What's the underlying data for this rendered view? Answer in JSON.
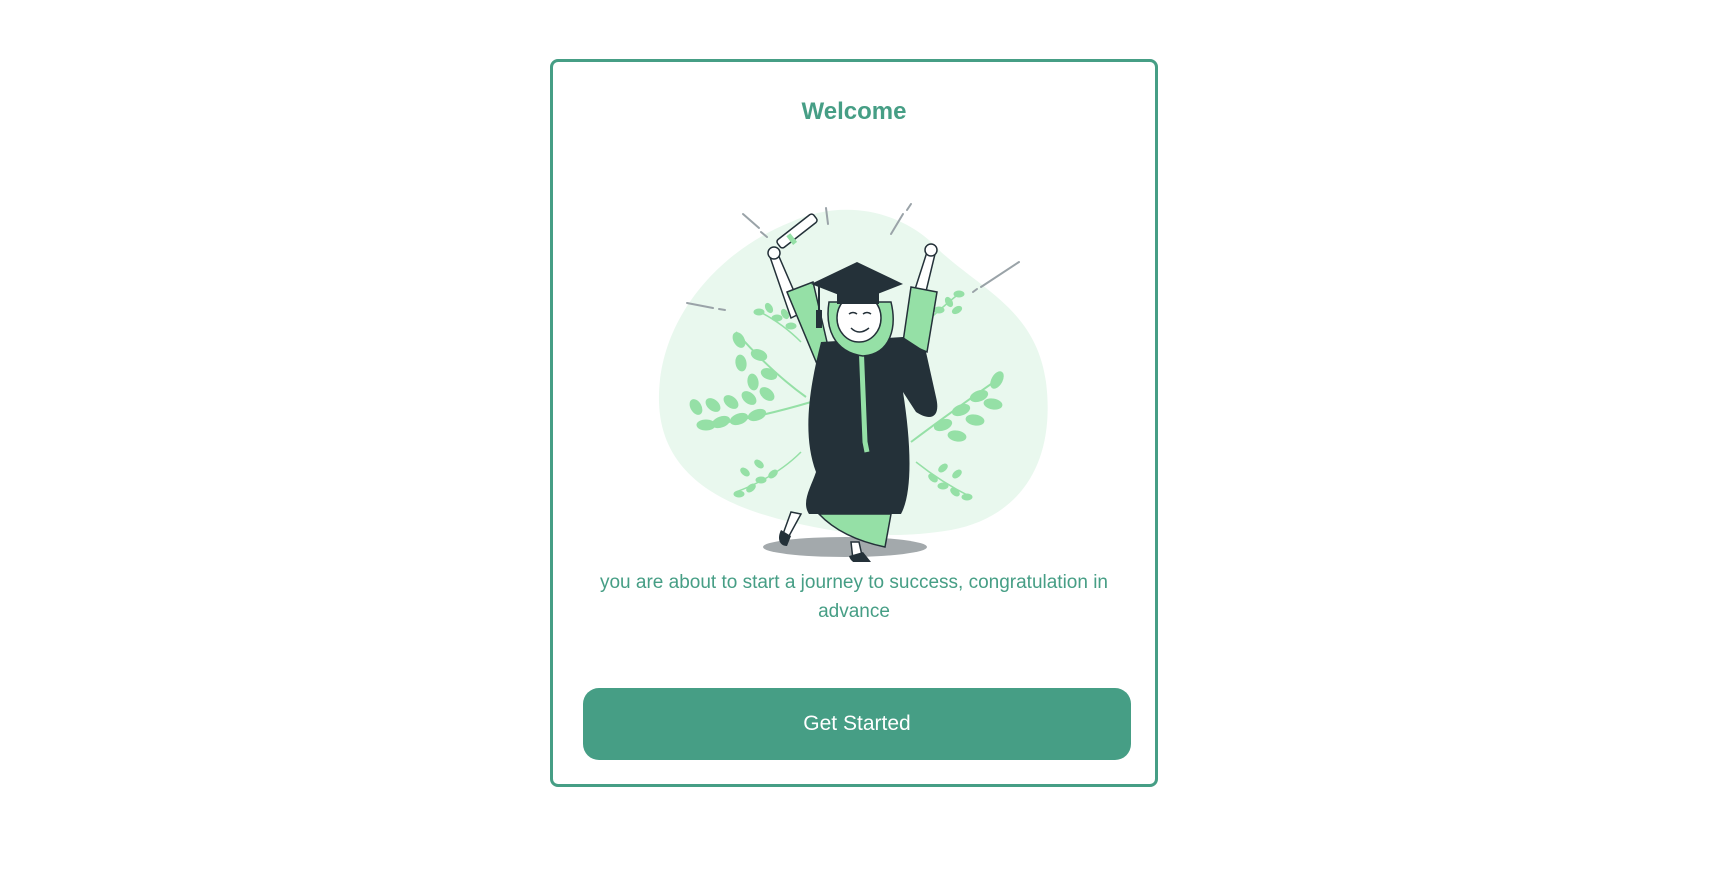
{
  "welcome_card": {
    "title": "Welcome",
    "illustration": {
      "icon": "graduation-celebration-illustration",
      "colors": {
        "blob": "#e9f8ee",
        "leaf": "#95e0a6",
        "gown": "#243139",
        "accent": "#469e85"
      }
    },
    "message": "you are about to start a journey to success, congratulation in advance",
    "cta_label": "Get Started"
  },
  "theme": {
    "accent": "#469e85",
    "background": "#ffffff"
  }
}
